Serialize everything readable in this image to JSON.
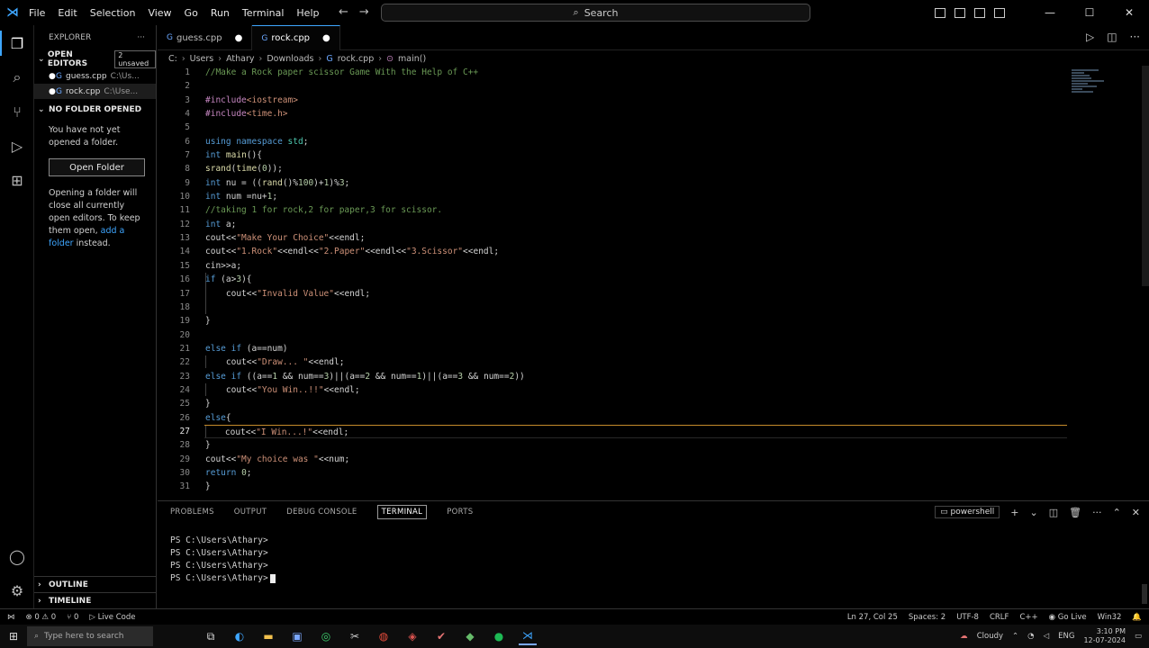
{
  "menu": [
    "File",
    "Edit",
    "Selection",
    "View",
    "Go",
    "Run",
    "Terminal",
    "Help"
  ],
  "search": {
    "label": "Search"
  },
  "sidebar": {
    "title": "EXPLORER",
    "open_editors": "OPEN EDITORS",
    "unsaved_badge": "2 unsaved",
    "files": [
      {
        "name": "guess.cpp",
        "path": "C:\\Us..."
      },
      {
        "name": "rock.cpp",
        "path": "C:\\Use..."
      }
    ],
    "no_folder": "NO FOLDER OPENED",
    "no_folder_msg": "You have not yet opened a folder.",
    "open_folder_btn": "Open Folder",
    "info_text": "Opening a folder will close all currently open editors. To keep them open,",
    "info_link": "add a folder",
    "info_suffix": "instead.",
    "outline": "OUTLINE",
    "timeline": "TIMELINE"
  },
  "tabs": [
    {
      "name": "guess.cpp",
      "active": false
    },
    {
      "name": "rock.cpp",
      "active": true
    }
  ],
  "breadcrumb": [
    "C:",
    "Users",
    "Athary",
    "Downloads",
    "rock.cpp",
    "main()"
  ],
  "code": {
    "line_numbers": [
      "1",
      "2",
      "3",
      "4",
      "5",
      "6",
      "7",
      "8",
      "9",
      "10",
      "11",
      "12",
      "13",
      "14",
      "15",
      "16",
      "17",
      "18",
      "19",
      "20",
      "21",
      "22",
      "23",
      "24",
      "25",
      "26",
      "27",
      "28",
      "29",
      "30",
      "31"
    ],
    "current_line": 27
  },
  "panel": {
    "tabs": [
      "PROBLEMS",
      "OUTPUT",
      "DEBUG CONSOLE",
      "TERMINAL",
      "PORTS"
    ],
    "active_tab": "TERMINAL",
    "shell": "powershell",
    "lines": [
      "PS C:\\Users\\Athary>",
      "PS C:\\Users\\Athary>",
      "PS C:\\Users\\Athary>",
      "PS C:\\Users\\Athary>"
    ]
  },
  "status": {
    "left": [
      "⊗ 0 ⚠ 0",
      "⑂ 0",
      "▷ Live Code"
    ],
    "position": "Ln 27, Col 25",
    "spaces": "Spaces: 2",
    "encoding": "UTF-8",
    "eol": "CRLF",
    "language": "C++",
    "golive": "Go Live",
    "platform": "Win32"
  },
  "taskbar": {
    "search_placeholder": "Type here to search",
    "weather": "Cloudy",
    "lang": "ENG",
    "time": "3:10 PM",
    "date": "12-07-2024"
  },
  "colors": {
    "accent": "#3ea6ff",
    "bg": "#000000",
    "current_line": "#c58a2a"
  }
}
